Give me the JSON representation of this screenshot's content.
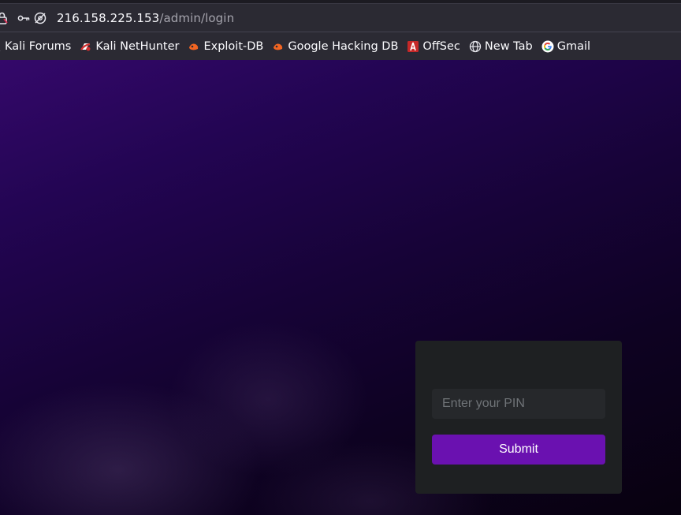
{
  "browser": {
    "url_host": "216.158.225.153",
    "url_path": "/admin/login",
    "bookmarks": [
      {
        "label": "Kali Forums",
        "icon": "kali-icon"
      },
      {
        "label": "Kali NetHunter",
        "icon": "nethunter-icon"
      },
      {
        "label": "Exploit-DB",
        "icon": "exploitdb-icon"
      },
      {
        "label": "Google Hacking DB",
        "icon": "ghdb-icon"
      },
      {
        "label": "OffSec",
        "icon": "offsec-icon"
      },
      {
        "label": "New Tab",
        "icon": "globe-icon"
      },
      {
        "label": "Gmail",
        "icon": "google-icon"
      }
    ]
  },
  "login": {
    "pin_placeholder": "Enter your PIN",
    "pin_value": "",
    "submit_label": "Submit"
  },
  "colors": {
    "accent": "#6a11b0",
    "card": "#1e2022",
    "background_top": "#34086a",
    "background_bottom": "#08010f"
  }
}
